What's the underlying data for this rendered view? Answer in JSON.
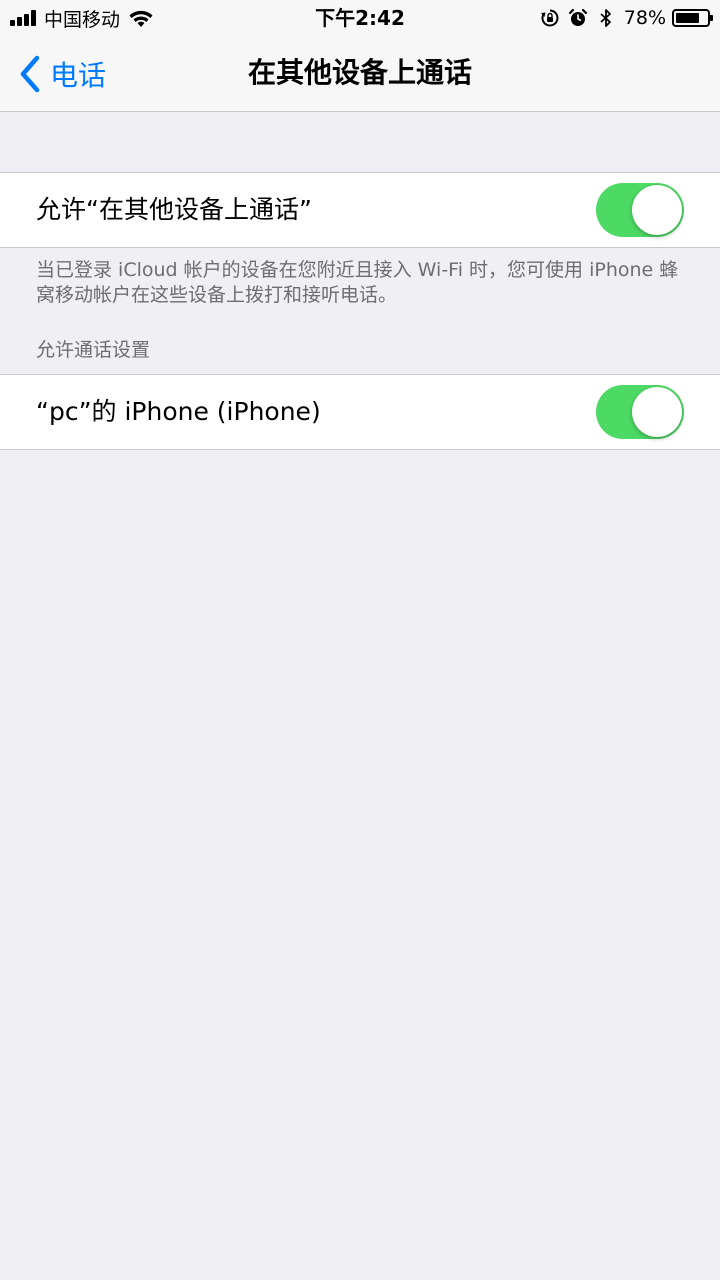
{
  "status_bar": {
    "carrier": "中国移动",
    "time": "下午2:42",
    "battery_percent": "78%",
    "battery_level": 0.78,
    "icons": [
      "signal-icon",
      "wifi-icon",
      "orientation-lock-icon",
      "alarm-icon",
      "bluetooth-icon",
      "battery-icon"
    ]
  },
  "nav": {
    "back_label": "电话",
    "title": "在其他设备上通话"
  },
  "main_toggle": {
    "label": "允许“在其他设备上通话”",
    "on": true
  },
  "footer": {
    "text": "当已登录 iCloud 帐户的设备在您附近且接入 Wi-Fi 时，您可使用 iPhone 蜂窝移动帐户在这些设备上拨打和接听电话。"
  },
  "devices_section": {
    "header": "允许通话设置",
    "items": [
      {
        "label": "“pc”的 iPhone (iPhone)",
        "on": true
      }
    ]
  },
  "colors": {
    "accent": "#007aff",
    "switch_on": "#4cd964",
    "background": "#efeff4",
    "secondary_text": "#6d6d72"
  }
}
